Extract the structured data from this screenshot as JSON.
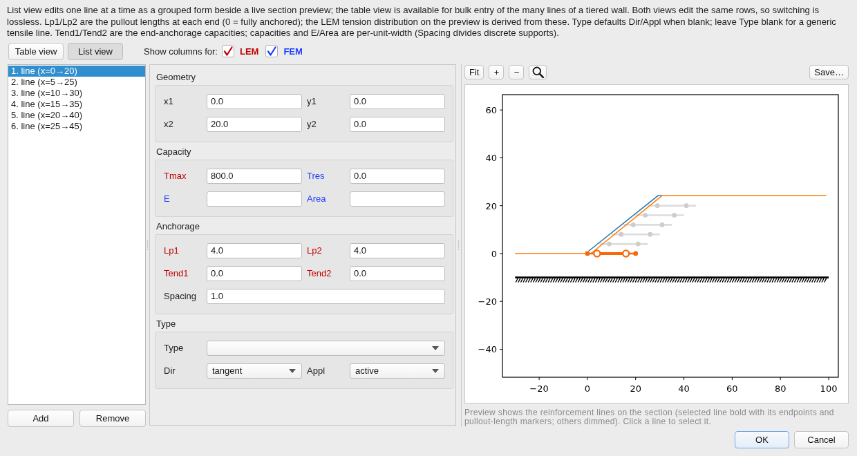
{
  "description": "List view edits one line at a time as a grouped form beside a live section preview; the table view is available for bulk entry of the many lines of a tiered wall. Both views edit the same rows, so switching is lossless. Lp1/Lp2 are the pullout lengths at each end (0 = fully anchored); the LEM tension distribution on the preview is derived from these. Type defaults Dir/Appl when blank; leave Type blank for a generic tensile line. Tend1/Tend2 are the end-anchorage capacities; capacities and E/Area are per-unit-width (Spacing divides discrete supports).",
  "view_buttons": [
    {
      "label": "Table view",
      "selected": false
    },
    {
      "label": "List view",
      "selected": true
    }
  ],
  "show_columns": {
    "label": "Show columns for:",
    "options": [
      {
        "label": "LEM",
        "checked": true,
        "color": "#c00000"
      },
      {
        "label": "FEM",
        "checked": true,
        "color": "#1a3cff"
      }
    ]
  },
  "lines_list": {
    "items": [
      {
        "label": "1. line (x=0→20)",
        "selected": true
      },
      {
        "label": "2. line (x=5→25)",
        "selected": false
      },
      {
        "label": "3. line (x=10→30)",
        "selected": false
      },
      {
        "label": "4. line (x=15→35)",
        "selected": false
      },
      {
        "label": "5. line (x=20→40)",
        "selected": false
      },
      {
        "label": "6. line (x=25→45)",
        "selected": false
      }
    ],
    "buttons": [
      "Add",
      "Remove"
    ]
  },
  "form": {
    "groups": [
      {
        "title": "Geometry",
        "rows": [
          [
            {
              "label": "x1",
              "kind": "text",
              "value": "0.0"
            },
            {
              "label": "y1",
              "kind": "text",
              "value": "0.0"
            }
          ],
          [
            {
              "label": "x2",
              "kind": "text",
              "value": "20.0"
            },
            {
              "label": "y2",
              "kind": "text",
              "value": "0.0"
            }
          ]
        ]
      },
      {
        "title": "Capacity",
        "rows": [
          [
            {
              "label": "Tmax",
              "color": "#c00000",
              "kind": "text",
              "value": "800.0"
            },
            {
              "label": "Tres",
              "color": "#1a3cff",
              "kind": "text",
              "value": "0.0"
            }
          ],
          [
            {
              "label": "E",
              "color": "#1a3cff",
              "kind": "text"
            },
            {
              "label": "Area",
              "color": "#1a3cff",
              "kind": "text"
            }
          ]
        ]
      },
      {
        "title": "Anchorage",
        "rows": [
          [
            {
              "label": "Lp1",
              "color": "#c00000",
              "kind": "text",
              "value": "4.0"
            },
            {
              "label": "Lp2",
              "color": "#c00000",
              "kind": "text",
              "value": "4.0"
            }
          ],
          [
            {
              "label": "Tend1",
              "color": "#c00000",
              "kind": "text",
              "value": "0.0"
            },
            {
              "label": "Tend2",
              "color": "#c00000",
              "kind": "text",
              "value": "0.0"
            }
          ],
          [
            {
              "label": "Spacing",
              "kind": "text",
              "value": "1.0"
            }
          ]
        ]
      },
      {
        "title": "Type",
        "rows": [
          [
            {
              "label": "Type",
              "kind": "combo"
            }
          ],
          [
            {
              "label": "Dir",
              "kind": "combo",
              "value": "tangent"
            },
            {
              "label": "Appl",
              "kind": "combo",
              "value": "active"
            }
          ]
        ]
      }
    ]
  },
  "preview": {
    "toolbar": [
      "Fit",
      "+",
      "−"
    ],
    "save_button": "Save…",
    "chart_data": {
      "type": "line",
      "xlim": [
        -35.2,
        104
      ],
      "ylim": [
        -51.7,
        66.4
      ],
      "xticks": [
        {
          "value": -20,
          "label": "−20"
        },
        0,
        20,
        40,
        60,
        80,
        100
      ],
      "yticks": [
        {
          "value": -40,
          "label": "−40"
        },
        {
          "value": -20,
          "label": "−20"
        },
        0,
        20,
        40,
        60
      ],
      "series": [
        {
          "color": "#dcdcdc",
          "x": [
            5,
            25
          ],
          "values": [
            4,
            4
          ]
        },
        {
          "type": "scatter",
          "color": "#cdcdcd",
          "x": [
            9,
            21
          ],
          "values": [
            4,
            4
          ],
          "marker": "circle"
        },
        {
          "color": "#dcdcdc",
          "x": [
            10,
            30
          ],
          "values": [
            8,
            8
          ]
        },
        {
          "type": "scatter",
          "color": "#cdcdcd",
          "x": [
            14,
            26
          ],
          "values": [
            8,
            8
          ],
          "marker": "circle"
        },
        {
          "color": "#dcdcdc",
          "x": [
            15,
            35
          ],
          "values": [
            12,
            12
          ]
        },
        {
          "type": "scatter",
          "color": "#cdcdcd",
          "x": [
            19,
            31
          ],
          "values": [
            12,
            12
          ],
          "marker": "circle"
        },
        {
          "color": "#dcdcdc",
          "x": [
            20,
            40
          ],
          "values": [
            16,
            16
          ]
        },
        {
          "type": "scatter",
          "color": "#cdcdcd",
          "x": [
            24,
            36
          ],
          "values": [
            16,
            16
          ],
          "marker": "circle"
        },
        {
          "color": "#dcdcdc",
          "x": [
            25,
            45
          ],
          "values": [
            20,
            20
          ]
        },
        {
          "type": "scatter",
          "color": "#cdcdcd",
          "x": [
            29,
            41
          ],
          "values": [
            20,
            20
          ],
          "marker": "circle"
        },
        {
          "color": "#1f77b4",
          "x": [
            0.5,
            29.3,
            31
          ],
          "values": [
            1,
            24.2,
            24.2
          ]
        },
        {
          "color": "#ff7f0e",
          "x": [
            -30,
            1.4,
            31,
            99
          ],
          "values": [
            0,
            0,
            24.2,
            24.2
          ]
        },
        {
          "color": "#000000",
          "x": [
            -30,
            100
          ],
          "values": [
            -10,
            -10
          ]
        },
        {
          "color": "#f5680c",
          "x": [
            0,
            20
          ],
          "values": [
            0,
            0
          ],
          "marker": "circle"
        },
        {
          "color": "#f5680c",
          "x": [
            4,
            16
          ],
          "values": [
            0,
            0
          ],
          "marker": "circle"
        }
      ]
    },
    "caption": "Preview shows the reinforcement lines on the section (selected line bold with its endpoints and pullout-length markers; others dimmed). Click a line to select it."
  },
  "dialog_buttons": [
    {
      "label": "OK",
      "default": true
    },
    {
      "label": "Cancel",
      "default": false
    }
  ]
}
